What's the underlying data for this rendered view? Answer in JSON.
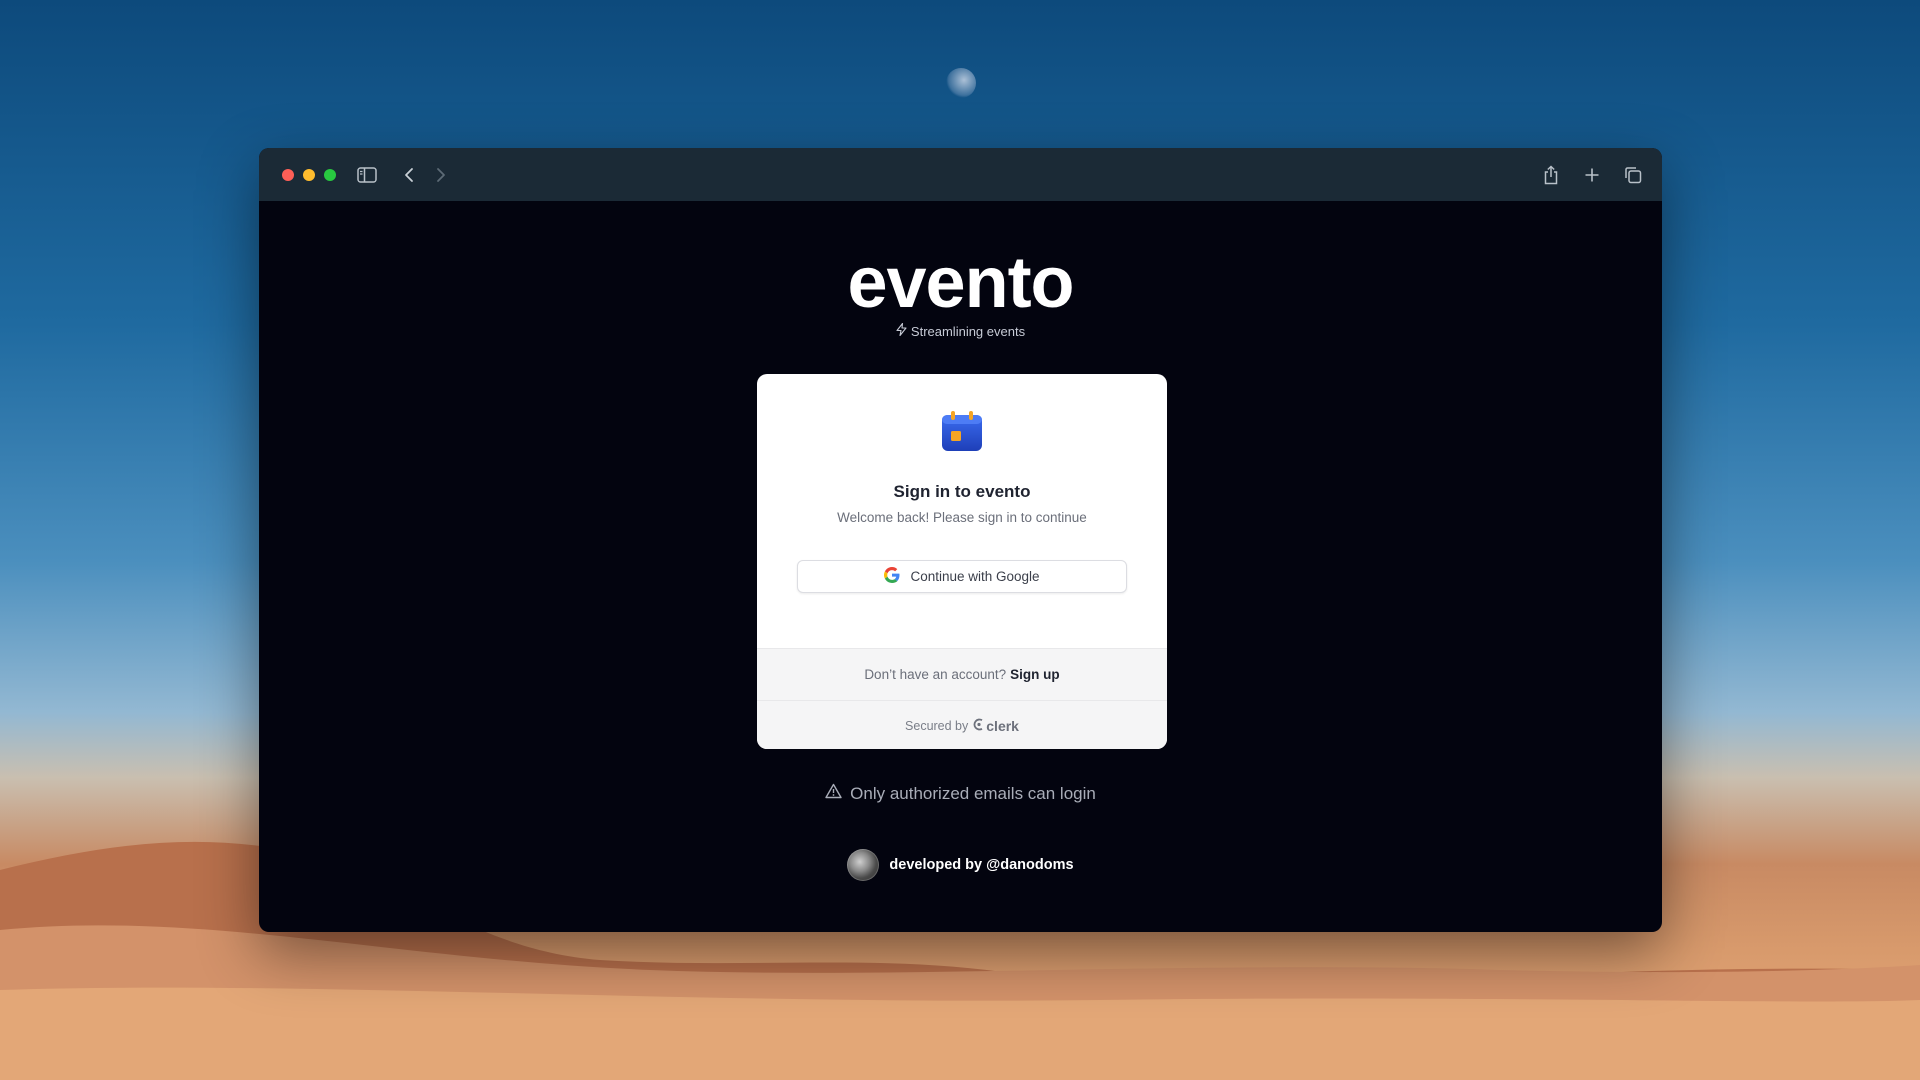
{
  "app": {
    "brand": "evento",
    "tagline": "Streamlining events"
  },
  "signin_card": {
    "title": "Sign in to evento",
    "subtitle": "Welcome back! Please sign in to continue",
    "google_button_label": "Continue with Google",
    "footer": {
      "prompt": "Don’t have an account?",
      "signup_label": "Sign up",
      "secured_by": "Secured by",
      "provider": "clerk"
    }
  },
  "notice": "Only authorized emails can login",
  "developer": "developed by @danodoms",
  "icons": [
    "sidebar-icon",
    "back-icon",
    "forward-icon",
    "share-icon",
    "new-tab-icon",
    "tabs-overview-icon",
    "sparkle-icon",
    "calendar-icon",
    "google-icon",
    "clerk-icon",
    "warning-icon"
  ],
  "colors": {
    "page_bg": "#03040f",
    "titlebar": "#1b2a36",
    "card_bg": "#ffffff",
    "calendar_blue": "#2b54d6",
    "calendar_accent": "#f5a524"
  }
}
